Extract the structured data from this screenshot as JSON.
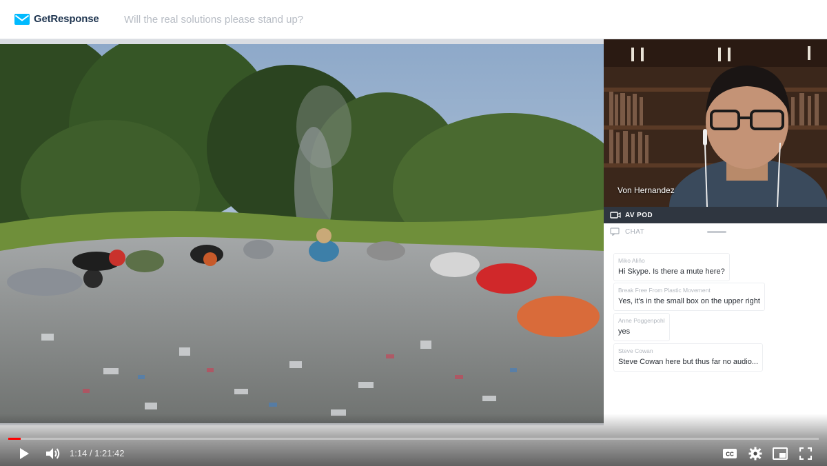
{
  "header": {
    "brand": "GetResponse",
    "webinar_title": "Will the real solutions please stand up?"
  },
  "presenter": {
    "name": "Von Hernandez"
  },
  "av_pod": {
    "label": "AV POD"
  },
  "chat": {
    "label": "CHAT",
    "messages": [
      {
        "author": "Miko Aliño",
        "text": "Hi Skype. Is there a mute here?"
      },
      {
        "author": "Break Free From Plastic Movement",
        "text": "Yes, it's in the small box on the upper right"
      },
      {
        "author": "Anne Poggenpohl",
        "text": "yes"
      },
      {
        "author": "Steve Cowan",
        "text": "Steve Cowan here but thus far no audio..."
      }
    ]
  },
  "player": {
    "time_display": "1:14 / 1:21:42",
    "progress": 0.015
  },
  "icons": {
    "play": "play-icon",
    "volume": "volume-icon",
    "captions": "captions-icon",
    "settings": "gear-icon",
    "miniplayer": "miniplayer-icon",
    "fullscreen": "fullscreen-icon"
  },
  "colors": {
    "brand_blue": "#00baff",
    "progress_red": "#ff0000",
    "av_bar": "#2f3640"
  }
}
